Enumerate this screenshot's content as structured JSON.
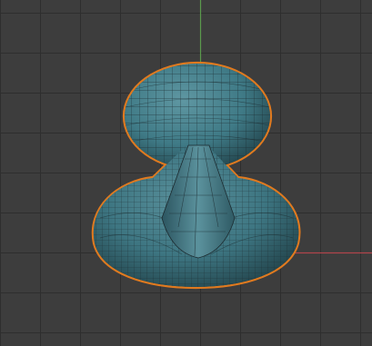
{
  "viewport": {
    "background_color": "#3d3d3d",
    "grid_color": "#2e2e2e",
    "axes": {
      "x_axis_color": "#b0444c",
      "y_axis_color": "#5a9a4c"
    }
  },
  "mesh": {
    "object_icon": "mesh-object",
    "surface_color": "#3f7a86",
    "wire_color": "#1c2b30",
    "selection_outline_color": "#e07a1f",
    "selected": true
  }
}
